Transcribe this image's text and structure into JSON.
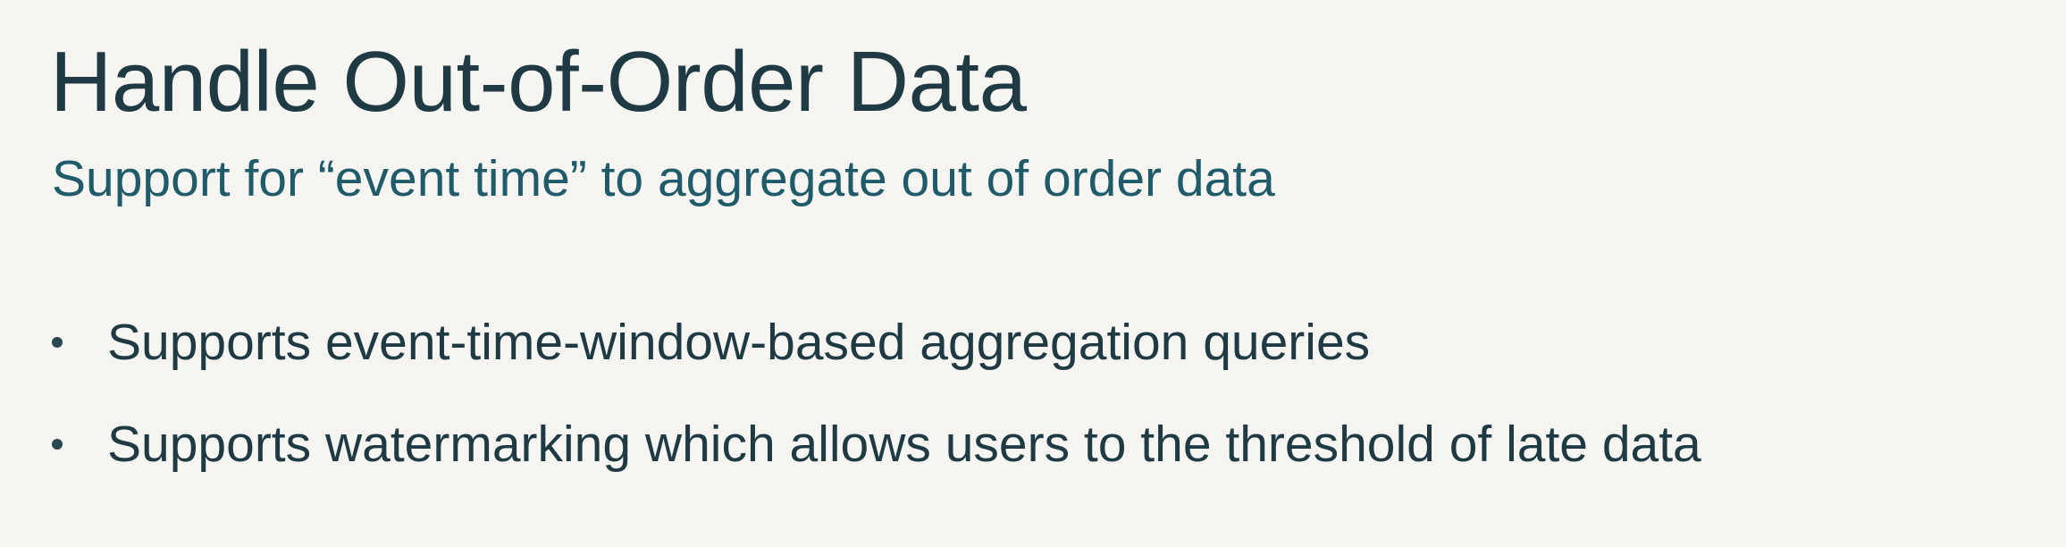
{
  "slide": {
    "title": "Handle Out-of-Order Data",
    "subtitle": "Support for “event time” to aggregate out of order data",
    "bullets": [
      "Supports event-time-window-based aggregation queries",
      "Supports watermarking which allows users to the threshold of late data"
    ]
  },
  "colors": {
    "background": "#f7f5f2",
    "title": "#1f3a42",
    "subtitle": "#1f5b68",
    "bullet_text": "#1f3a42"
  }
}
